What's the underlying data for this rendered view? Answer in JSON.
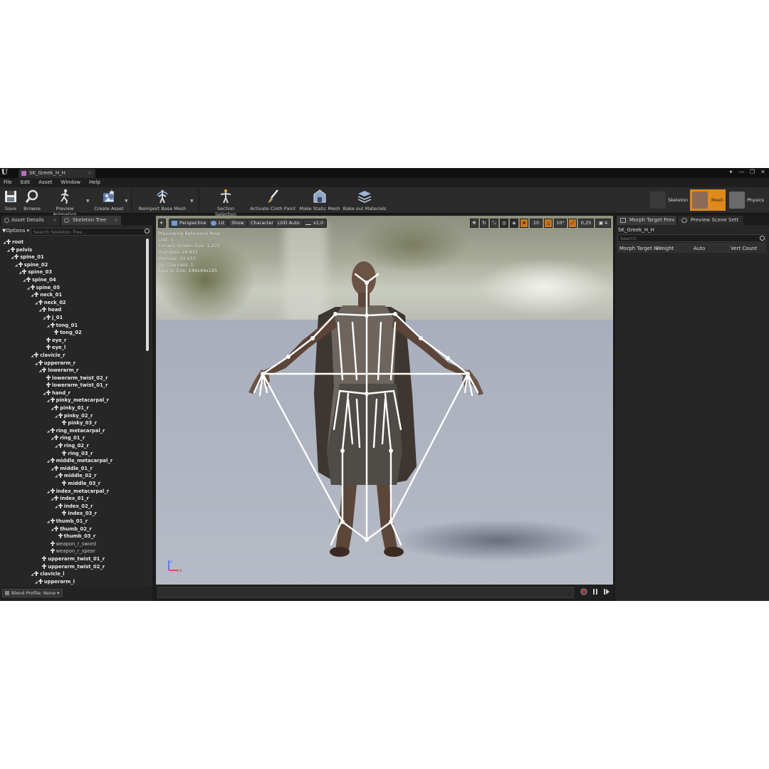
{
  "titlebar": {
    "logo": "U",
    "tab_label": "SK_Greek_H_H",
    "tab_close": "×",
    "window_buttons": [
      "▾",
      "—",
      "❐",
      "✕"
    ]
  },
  "menu": [
    "File",
    "Edit",
    "Asset",
    "Window",
    "Help"
  ],
  "toolbar": {
    "save": "Save",
    "browse": "Browse",
    "preview_animation": "Preview Animation",
    "create_asset": "Create Asset",
    "reimport": "Reimport Base Mesh",
    "section_selection": "Section Selection",
    "activate_cloth_paint": "Activate Cloth Paint",
    "make_static_mesh": "Make Static Mesh",
    "bake_out_materials": "Bake out Materials",
    "modes": {
      "skeleton": "Skeleton",
      "mesh": "Mesh",
      "physics": "Physics"
    }
  },
  "left_panel": {
    "tab_asset_details": "Asset Details",
    "tab_skeleton_tree": "Skeleton Tree",
    "tab_close": "×",
    "options": "Options ▾",
    "search_placeholder": "Search Skeleton Tree...",
    "tree": [
      {
        "label": "root",
        "depth": 0,
        "expand": "◢"
      },
      {
        "label": "pelvis",
        "depth": 1,
        "expand": "◢"
      },
      {
        "label": "spine_01",
        "depth": 2,
        "expand": "◢"
      },
      {
        "label": "spine_02",
        "depth": 3,
        "expand": "◢"
      },
      {
        "label": "spine_03",
        "depth": 4,
        "expand": "◢"
      },
      {
        "label": "spine_04",
        "depth": 5,
        "expand": "◢"
      },
      {
        "label": "spine_05",
        "depth": 6,
        "expand": "◢"
      },
      {
        "label": "neck_01",
        "depth": 7,
        "expand": "◢"
      },
      {
        "label": "neck_02",
        "depth": 8,
        "expand": "◢"
      },
      {
        "label": "head",
        "depth": 9,
        "expand": "◢"
      },
      {
        "label": "j_01",
        "depth": 10,
        "expand": "◢"
      },
      {
        "label": "tong_01",
        "depth": 11,
        "expand": "◢"
      },
      {
        "label": "tong_02",
        "depth": 12,
        "expand": ""
      },
      {
        "label": "eye_r",
        "depth": 10,
        "expand": ""
      },
      {
        "label": "eye_l",
        "depth": 10,
        "expand": ""
      },
      {
        "label": "clavicle_r",
        "depth": 7,
        "expand": "◢"
      },
      {
        "label": "upperarm_r",
        "depth": 8,
        "expand": "◢"
      },
      {
        "label": "lowerarm_r",
        "depth": 9,
        "expand": "◢"
      },
      {
        "label": "lowerarm_twist_02_r",
        "depth": 10,
        "expand": ""
      },
      {
        "label": "lowerarm_twist_01_r",
        "depth": 10,
        "expand": ""
      },
      {
        "label": "hand_r",
        "depth": 10,
        "expand": "◢"
      },
      {
        "label": "pinky_metacarpal_r",
        "depth": 11,
        "expand": "◢"
      },
      {
        "label": "pinky_01_r",
        "depth": 12,
        "expand": "◢"
      },
      {
        "label": "pinky_02_r",
        "depth": 13,
        "expand": "◢"
      },
      {
        "label": "pinky_03_r",
        "depth": 14,
        "expand": ""
      },
      {
        "label": "ring_metacarpal_r",
        "depth": 11,
        "expand": "◢"
      },
      {
        "label": "ring_01_r",
        "depth": 12,
        "expand": "◢"
      },
      {
        "label": "ring_02_r",
        "depth": 13,
        "expand": "◢"
      },
      {
        "label": "ring_03_r",
        "depth": 14,
        "expand": ""
      },
      {
        "label": "middle_metacarpal_r",
        "depth": 11,
        "expand": "◢"
      },
      {
        "label": "middle_01_r",
        "depth": 12,
        "expand": "◢"
      },
      {
        "label": "middle_02_r",
        "depth": 13,
        "expand": "◢"
      },
      {
        "label": "middle_03_r",
        "depth": 14,
        "expand": ""
      },
      {
        "label": "index_metacarpal_r",
        "depth": 11,
        "expand": "◢"
      },
      {
        "label": "index_01_r",
        "depth": 12,
        "expand": "◢"
      },
      {
        "label": "index_02_r",
        "depth": 13,
        "expand": "◢"
      },
      {
        "label": "index_03_r",
        "depth": 14,
        "expand": ""
      },
      {
        "label": "thumb_01_r",
        "depth": 11,
        "expand": "◢"
      },
      {
        "label": "thumb_02_r",
        "depth": 12,
        "expand": "◢"
      },
      {
        "label": "thumb_03_r",
        "depth": 13,
        "expand": ""
      },
      {
        "label": "weapon_r_sword",
        "depth": 11,
        "expand": "",
        "dim": true
      },
      {
        "label": "weapon_r_spear",
        "depth": 11,
        "expand": "",
        "dim": true
      },
      {
        "label": "upperarm_twist_01_r",
        "depth": 9,
        "expand": ""
      },
      {
        "label": "upperarm_twist_02_r",
        "depth": 9,
        "expand": ""
      },
      {
        "label": "clavicle_l",
        "depth": 7,
        "expand": "◢"
      },
      {
        "label": "upperarm_l",
        "depth": 8,
        "expand": "◢"
      }
    ],
    "blend_profile": "Blend Profile: None ▾"
  },
  "viewport": {
    "menu_arrow": "▾",
    "perspective": "Perspective",
    "lit": "Lit",
    "show": "Show",
    "character": "Character",
    "lod": "LOD Auto",
    "speed": "x1,0",
    "grid_snap": "10",
    "rot_snap": "10°",
    "scale_snap": "0,25",
    "camera_speed": "4",
    "stats": [
      "Previewing Reference Pose",
      "LOD: 0",
      "Current Screen Size: 1,072",
      "Triangles: 24 931",
      "Vertices: 14 633",
      "UV Channels: 1",
      "Approx Size: 149x49x185"
    ],
    "axis_z": "z",
    "axis_x": "x"
  },
  "right_panel": {
    "tab_morph": "Morph Target Prev",
    "tab_scene": "Preview Scene Sett",
    "asset_name": "SK_Greek_H_H",
    "search_placeholder": "Search",
    "col_name": "Morph Target N",
    "col_weight": "Weight",
    "col_auto": "Auto",
    "col_vert": "Vert Count"
  },
  "colors": {
    "accent": "#e08a1a",
    "panel": "#262626",
    "bone": "#ffffff"
  }
}
